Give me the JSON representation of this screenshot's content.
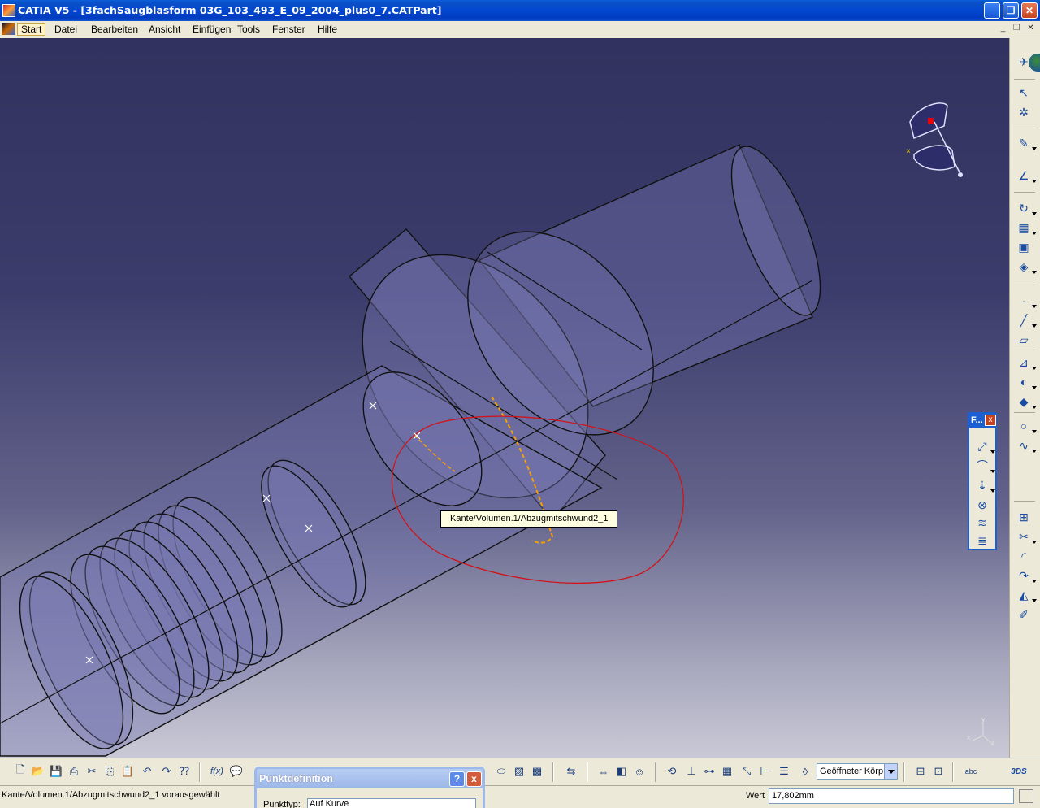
{
  "window": {
    "title": "CATIA V5 - [3fachSaugblasform 03G_103_493_E_09_2004_plus0_7.CATPart]",
    "min_icon": "minimize-icon",
    "max_icon": "restore-icon",
    "close_icon": "close-icon"
  },
  "menu": {
    "items": [
      {
        "label": "Start"
      },
      {
        "label": "Datei"
      },
      {
        "label": "Bearbeiten"
      },
      {
        "label": "Ansicht"
      },
      {
        "label": "Einfügen"
      },
      {
        "label": "Tools"
      },
      {
        "label": "Fenster"
      },
      {
        "label": "Hilfe"
      }
    ]
  },
  "viewport": {
    "tooltip": "Kante/Volumen.1/Abzugmitschwund2_1",
    "compass_labels": {
      "x": "x",
      "y": "y",
      "z": "z"
    }
  },
  "floating_toolbar": {
    "title": "F...",
    "close": "x"
  },
  "bottom_toolbar": {
    "layer_value": "Geöffneter Körp",
    "formula_label": "f(x)"
  },
  "status": {
    "message": "Kante/Volumen.1/Abzugmitschwund2_1 vorausgewählt",
    "wert_label": "Wert",
    "wert_value": "17,802mm"
  },
  "dialog": {
    "title": "Punktdefinition",
    "help": "?",
    "close": "x",
    "field_label": "Punkttyp:",
    "field_value": "Auf Kurve"
  },
  "colors": {
    "title_bar": "#0247cf",
    "background_top": "#32325f",
    "background_bottom": "#c9c9d6",
    "highlight_red": "#d0141a",
    "preselect_orange": "#f5a000"
  }
}
